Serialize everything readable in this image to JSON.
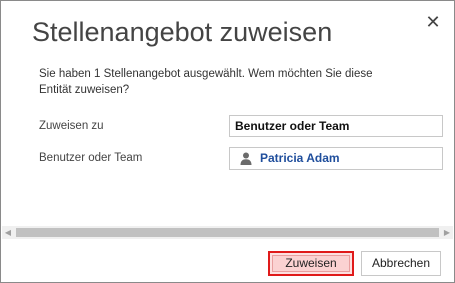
{
  "dialog": {
    "title": "Stellenangebot zuweisen",
    "close_icon": "close-icon",
    "message": "Sie haben 1 Stellenangebot ausgewählt. Wem möchten Sie diese Entität zuweisen?",
    "assign_to": {
      "label": "Zuweisen zu",
      "value": "Benutzer oder Team"
    },
    "user_or_team": {
      "label": "Benutzer oder Team",
      "icon": "person-icon",
      "value": "Patricia Adam"
    },
    "buttons": {
      "assign": "Zuweisen",
      "cancel": "Abbrechen"
    }
  },
  "colors": {
    "highlight_border": "#e01a1a",
    "link_blue": "#1f4e9c",
    "title_gray": "#444444"
  }
}
